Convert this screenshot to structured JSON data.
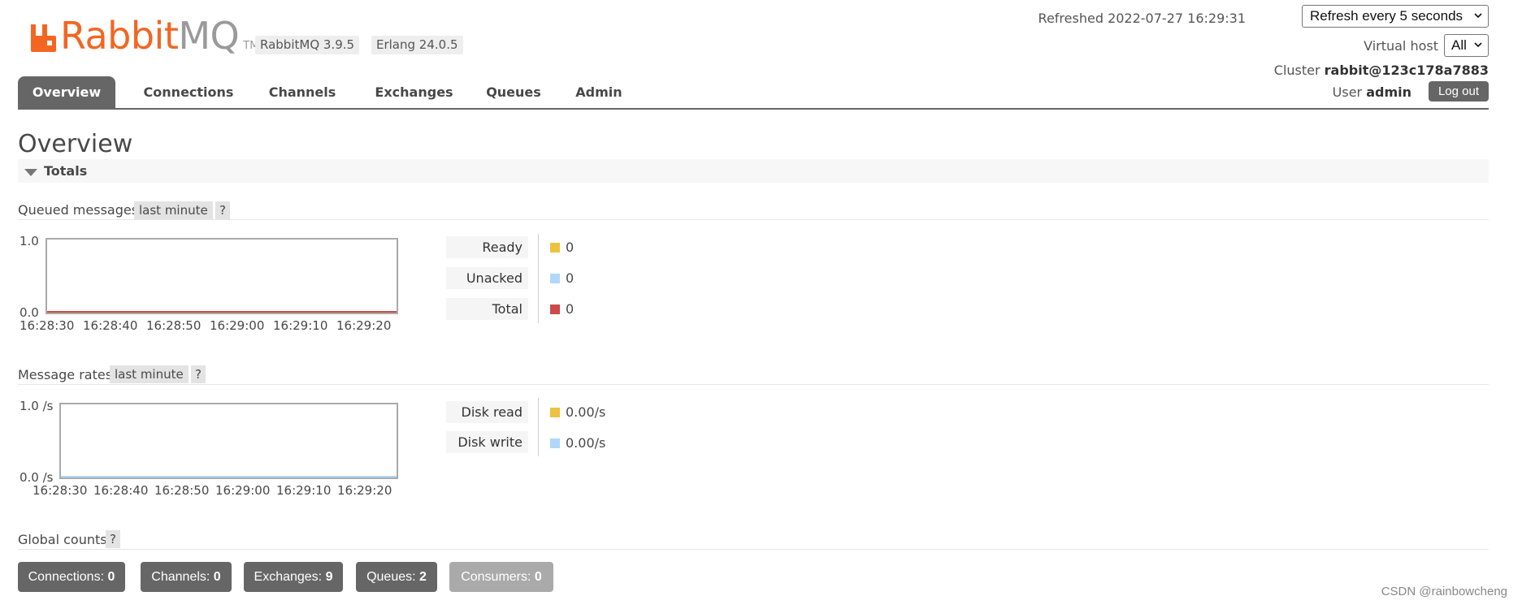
{
  "brand": {
    "name_a": "Rabbit",
    "name_b": "MQ",
    "tm": "TM"
  },
  "versions": {
    "rabbitmq": "RabbitMQ 3.9.5",
    "erlang": "Erlang 24.0.5"
  },
  "header": {
    "refreshed_label": "Refreshed",
    "refreshed_time": "2022-07-27 16:29:31",
    "refresh_option": "Refresh every 5 seconds",
    "vhost_label": "Virtual host",
    "vhost_value": "All",
    "cluster_label": "Cluster",
    "cluster_name": "rabbit@123c178a7883",
    "user_label": "User",
    "user_name": "admin",
    "logout_label": "Log out"
  },
  "nav": {
    "tabs": [
      {
        "label": "Overview",
        "active": true
      },
      {
        "label": "Connections",
        "active": false
      },
      {
        "label": "Channels",
        "active": false
      },
      {
        "label": "Exchanges",
        "active": false
      },
      {
        "label": "Queues",
        "active": false
      },
      {
        "label": "Admin",
        "active": false
      }
    ]
  },
  "page": {
    "title": "Overview",
    "totals_label": "Totals"
  },
  "queued": {
    "title": "Queued messages",
    "range": "last minute",
    "help": "?",
    "y_max": "1.0",
    "y_min": "0.0",
    "x_ticks": [
      "16:28:30",
      "16:28:40",
      "16:28:50",
      "16:29:00",
      "16:29:10",
      "16:29:20"
    ],
    "legend": [
      {
        "label": "Ready",
        "value": "0",
        "color": "#edc240"
      },
      {
        "label": "Unacked",
        "value": "0",
        "color": "#afd8f8"
      },
      {
        "label": "Total",
        "value": "0",
        "color": "#cb4b4b"
      }
    ]
  },
  "rates": {
    "title": "Message rates",
    "range": "last minute",
    "help": "?",
    "y_max": "1.0 /s",
    "y_min": "0.0 /s",
    "x_ticks": [
      "16:28:30",
      "16:28:40",
      "16:28:50",
      "16:29:00",
      "16:29:10",
      "16:29:20"
    ],
    "legend": [
      {
        "label": "Disk read",
        "value": "0.00/s",
        "color": "#edc240"
      },
      {
        "label": "Disk write",
        "value": "0.00/s",
        "color": "#afd8f8"
      }
    ]
  },
  "global": {
    "title": "Global counts",
    "help": "?",
    "counts": [
      {
        "label": "Connections:",
        "value": "0"
      },
      {
        "label": "Channels:",
        "value": "0"
      },
      {
        "label": "Exchanges:",
        "value": "9"
      },
      {
        "label": "Queues:",
        "value": "2"
      },
      {
        "label": "Consumers:",
        "value": "0"
      }
    ]
  },
  "watermark": "CSDN @rainbowcheng",
  "colors": {
    "brand_orange": "#f26622",
    "nav_active": "#666666",
    "series_total": "#cb4b4b",
    "series_write": "#afd8f8",
    "series_read": "#edc240"
  }
}
